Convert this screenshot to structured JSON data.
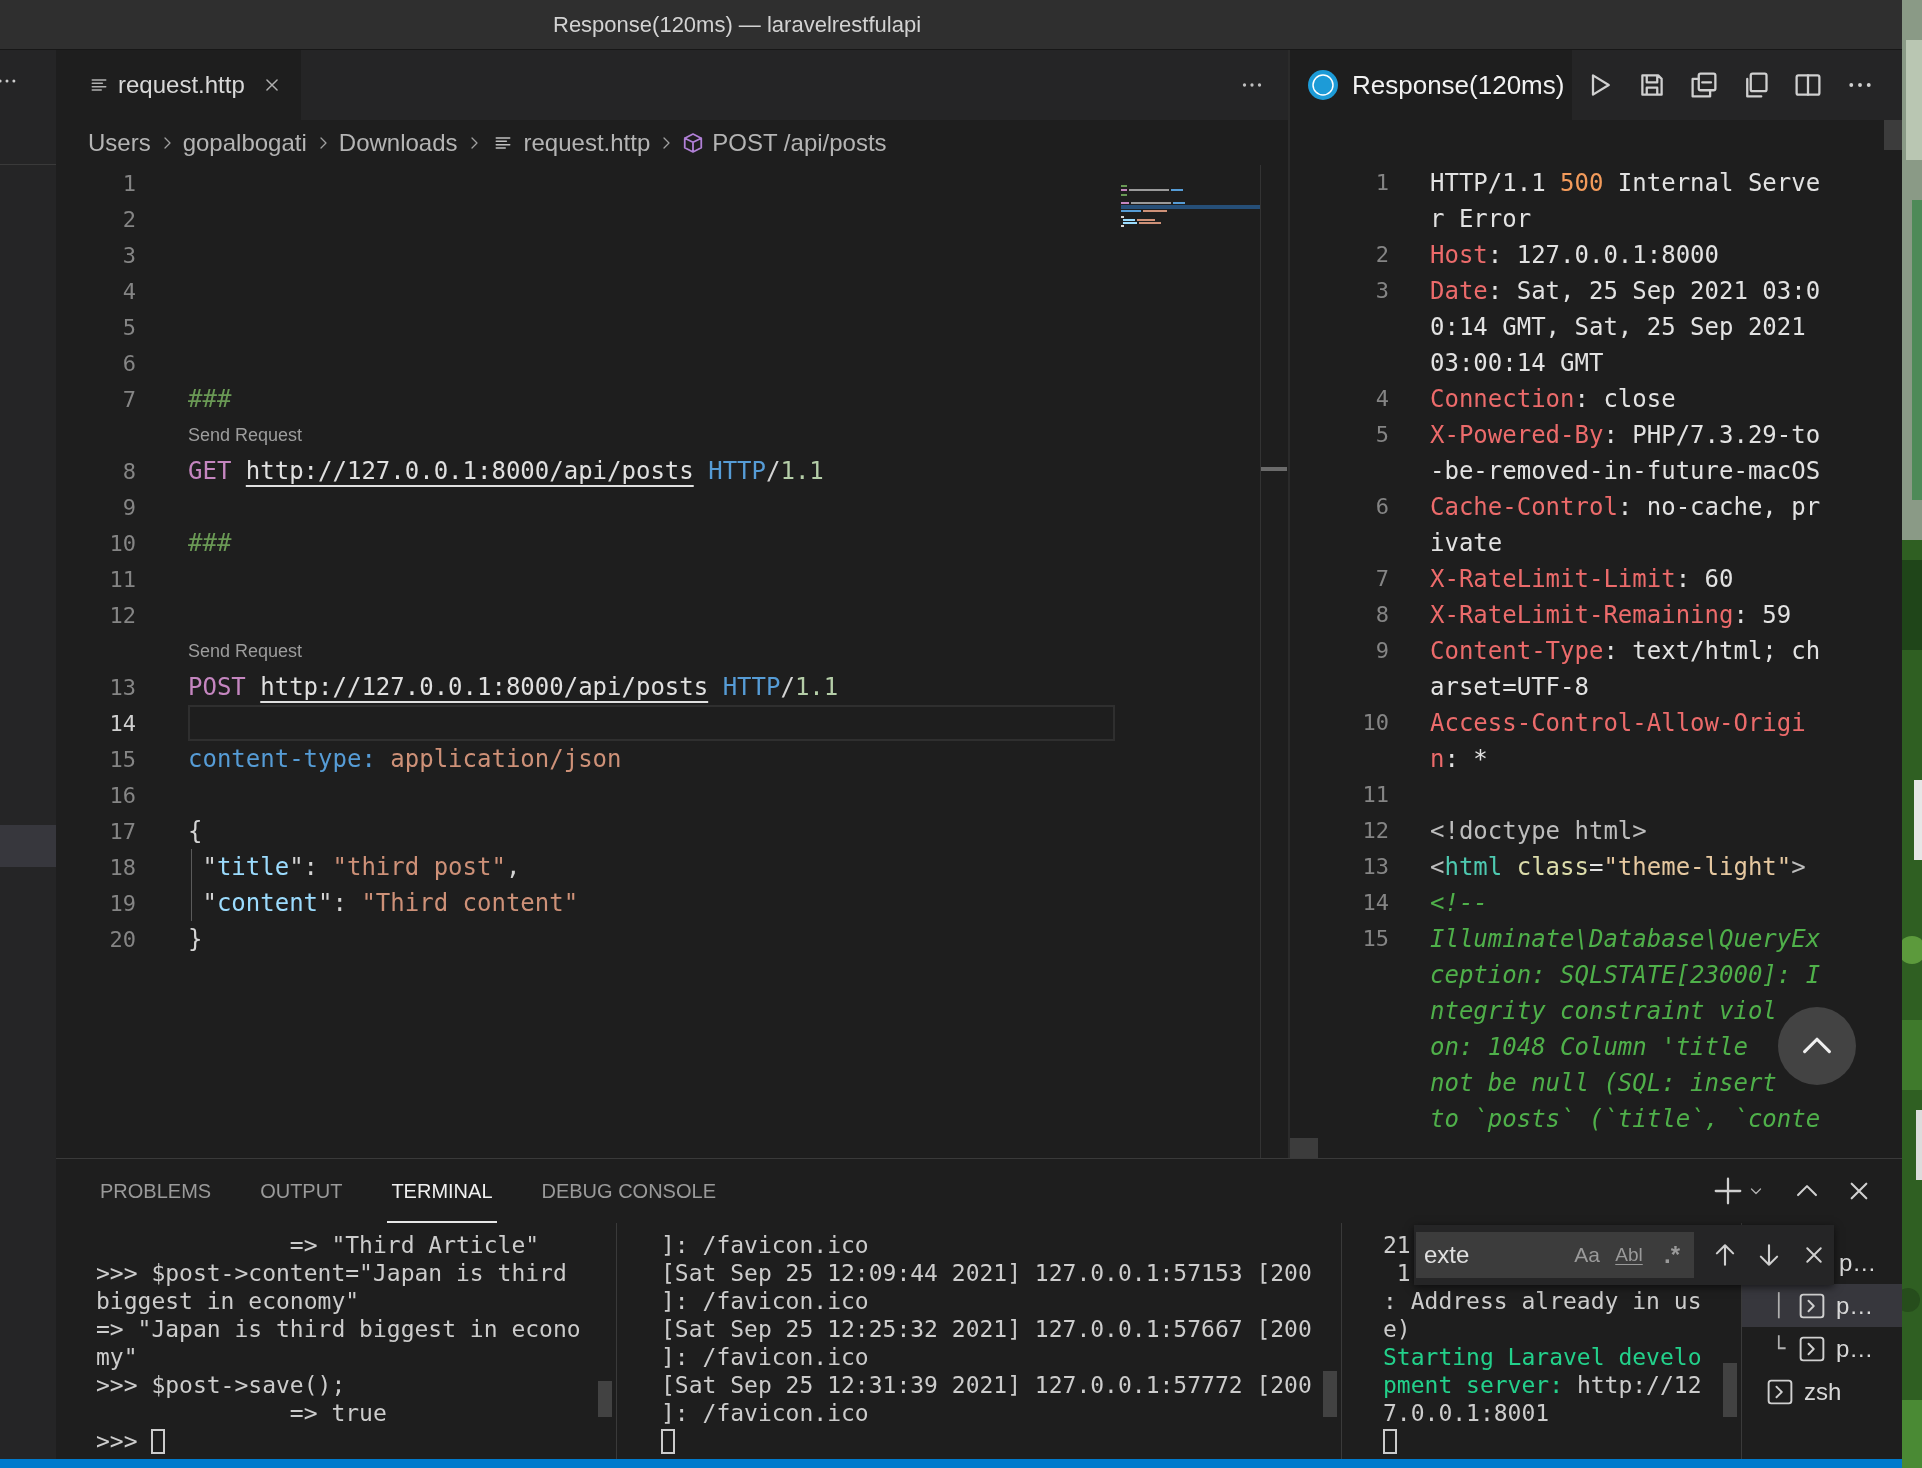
{
  "window": {
    "title": "Response(120ms) — laravelrestfulapi"
  },
  "editor": {
    "tabs": [
      {
        "label": "request.http",
        "selected": true
      }
    ],
    "breadcrumb": [
      {
        "label": "Users",
        "kind": "folder"
      },
      {
        "label": "gopalbogati",
        "kind": "folder"
      },
      {
        "label": "Downloads",
        "kind": "folder"
      },
      {
        "label": "request.http",
        "kind": "file"
      },
      {
        "label": "POST /api/posts",
        "kind": "symbol"
      }
    ],
    "lines": [
      {
        "number": "1",
        "current": false,
        "guide": false
      },
      {
        "number": "2",
        "current": false,
        "guide": false
      },
      {
        "number": "3",
        "current": false,
        "guide": false
      },
      {
        "number": "4",
        "current": false,
        "guide": false
      },
      {
        "number": "5",
        "current": false,
        "guide": false
      },
      {
        "number": "6",
        "current": false,
        "guide": false
      },
      {
        "number": "7",
        "current": false,
        "guide": false,
        "segments": [
          {
            "text": "###",
            "kind": "comment"
          }
        ]
      },
      {
        "number": "8",
        "current": false,
        "guide": false,
        "codelens": "Send Request",
        "segments": [
          {
            "text": "GET ",
            "kind": "method"
          },
          {
            "text": "http://127.0.0.1:8000/api/posts",
            "kind": "url"
          },
          {
            "text": " HTTP",
            "kind": "protocol"
          },
          {
            "text": "/",
            "kind": "plain"
          },
          {
            "text": "1.1",
            "kind": "version"
          }
        ]
      },
      {
        "number": "9",
        "current": false,
        "guide": false
      },
      {
        "number": "10",
        "current": false,
        "guide": false,
        "segments": [
          {
            "text": "###",
            "kind": "comment"
          }
        ]
      },
      {
        "number": "11",
        "current": false,
        "guide": false
      },
      {
        "number": "12",
        "current": false,
        "guide": false
      },
      {
        "number": "13",
        "current": false,
        "guide": false,
        "codelens": "Send Request",
        "segments": [
          {
            "text": "POST ",
            "kind": "method"
          },
          {
            "text": "http://127.0.0.1:8000/api/posts",
            "kind": "url"
          },
          {
            "text": " HTTP",
            "kind": "protocol"
          },
          {
            "text": "/",
            "kind": "plain"
          },
          {
            "text": "1.1",
            "kind": "version"
          }
        ]
      },
      {
        "number": "14",
        "current": true,
        "guide": false
      },
      {
        "number": "15",
        "current": false,
        "guide": false,
        "segments": [
          {
            "text": "content-type:",
            "kind": "key"
          },
          {
            "text": " application/json",
            "kind": "value"
          }
        ]
      },
      {
        "number": "16",
        "current": false,
        "guide": false
      },
      {
        "number": "17",
        "current": false,
        "guide": false,
        "segments": [
          {
            "text": "{",
            "kind": "plain"
          }
        ]
      },
      {
        "number": "18",
        "current": false,
        "guide": true,
        "segments": [
          {
            "text": " \"",
            "kind": "plain"
          },
          {
            "text": "title",
            "kind": "json_key"
          },
          {
            "text": "\": ",
            "kind": "plain"
          },
          {
            "text": "\"third post\"",
            "kind": "json_string"
          },
          {
            "text": ",",
            "kind": "plain"
          }
        ]
      },
      {
        "number": "19",
        "current": false,
        "guide": true,
        "segments": [
          {
            "text": " \"",
            "kind": "plain"
          },
          {
            "text": "content",
            "kind": "json_key"
          },
          {
            "text": "\": ",
            "kind": "plain"
          },
          {
            "text": "\"Third content\"",
            "kind": "json_string"
          }
        ]
      },
      {
        "number": "20",
        "current": false,
        "guide": false,
        "segments": [
          {
            "text": "}",
            "kind": "plain"
          }
        ]
      }
    ]
  },
  "response": {
    "tab": {
      "label": "Response(120ms)"
    },
    "lines": [
      {
        "number": "1",
        "rows": [
          [
            {
              "text": "HTTP/1.1 ",
              "kind": "plain"
            },
            {
              "text": "500",
              "kind": "status"
            },
            {
              "text": " Internal Serve",
              "kind": "plain"
            }
          ],
          [
            {
              "text": "r Error",
              "kind": "plain"
            }
          ]
        ]
      },
      {
        "number": "2",
        "rows": [
          [
            {
              "text": "Host",
              "kind": "name"
            },
            {
              "text": ": 127.0.0.1:8000",
              "kind": "plain"
            }
          ]
        ]
      },
      {
        "number": "3",
        "rows": [
          [
            {
              "text": "Date",
              "kind": "name"
            },
            {
              "text": ": Sat, 25 Sep 2021 03:0",
              "kind": "plain"
            }
          ],
          [
            {
              "text": "0:14 GMT, Sat, 25 Sep 2021",
              "kind": "plain"
            }
          ],
          [
            {
              "text": "03:00:14 GMT",
              "kind": "plain"
            }
          ]
        ]
      },
      {
        "number": "4",
        "rows": [
          [
            {
              "text": "Connection",
              "kind": "name"
            },
            {
              "text": ": close",
              "kind": "plain"
            }
          ]
        ]
      },
      {
        "number": "5",
        "rows": [
          [
            {
              "text": "X-Powered-By",
              "kind": "name"
            },
            {
              "text": ": PHP/7.3.29-to",
              "kind": "plain"
            }
          ],
          [
            {
              "text": "-be-removed-in-future-macOS",
              "kind": "plain"
            }
          ]
        ]
      },
      {
        "number": "6",
        "rows": [
          [
            {
              "text": "Cache-Control",
              "kind": "name"
            },
            {
              "text": ": no-cache, pr",
              "kind": "plain"
            }
          ],
          [
            {
              "text": "ivate",
              "kind": "plain"
            }
          ]
        ]
      },
      {
        "number": "7",
        "rows": [
          [
            {
              "text": "X-RateLimit-Limit",
              "kind": "name"
            },
            {
              "text": ": 60",
              "kind": "plain"
            }
          ]
        ]
      },
      {
        "number": "8",
        "rows": [
          [
            {
              "text": "X-RateLimit-Remaining",
              "kind": "name"
            },
            {
              "text": ": 59",
              "kind": "plain"
            }
          ]
        ]
      },
      {
        "number": "9",
        "rows": [
          [
            {
              "text": "Content-Type",
              "kind": "name"
            },
            {
              "text": ": text/html; ch",
              "kind": "plain"
            }
          ],
          [
            {
              "text": "arset=UTF-8",
              "kind": "plain"
            }
          ]
        ]
      },
      {
        "number": "10",
        "rows": [
          [
            {
              "text": "Access-Control-Allow-Origi",
              "kind": "name"
            }
          ],
          [
            {
              "text": "n",
              "kind": "name"
            },
            {
              "text": ": *",
              "kind": "plain"
            }
          ]
        ]
      },
      {
        "number": "11"
      },
      {
        "number": "12",
        "rows": [
          [
            {
              "text": "<!doctype html>",
              "kind": "punct"
            }
          ]
        ]
      },
      {
        "number": "13",
        "rows": [
          [
            {
              "text": "<",
              "kind": "punct"
            },
            {
              "text": "html",
              "kind": "tag"
            },
            {
              "text": " ",
              "kind": "plain"
            },
            {
              "text": "class",
              "kind": "attr"
            },
            {
              "text": "=",
              "kind": "plain"
            },
            {
              "text": "\"theme-light\"",
              "kind": "string"
            },
            {
              "text": ">",
              "kind": "punct"
            }
          ]
        ]
      },
      {
        "number": "14",
        "rows": [
          [
            {
              "text": "<!--",
              "kind": "comment"
            }
          ]
        ]
      },
      {
        "number": "15",
        "rows": [
          [
            {
              "text": "Illuminate\\Database\\QueryEx",
              "kind": "comment"
            }
          ],
          [
            {
              "text": "ception: SQLSTATE[23000]: I",
              "kind": "comment"
            }
          ],
          [
            {
              "text": "ntegrity constraint viol",
              "kind": "comment"
            }
          ],
          [
            {
              "text": "on: 1048 Column 'title",
              "kind": "comment"
            }
          ],
          [
            {
              "text": "not be null (SQL: insert",
              "kind": "comment"
            }
          ],
          [
            {
              "text": "to `posts` (`title`, `conte",
              "kind": "comment"
            }
          ]
        ]
      }
    ]
  },
  "panel": {
    "tabs": [
      {
        "label": "PROBLEMS",
        "selected": false
      },
      {
        "label": "OUTPUT",
        "selected": false
      },
      {
        "label": "TERMINAL",
        "selected": true
      },
      {
        "label": "DEBUG CONSOLE",
        "selected": false
      }
    ],
    "terminals": [
      {
        "prompt": ">>> ",
        "rows": [
          [
            {
              "text": "              => \"Third Article\"",
              "kind": "plain"
            }
          ],
          [
            {
              "text": ">>> $post->content=\"Japan is third",
              "kind": "plain"
            }
          ],
          [
            {
              "text": "biggest in economy\"",
              "kind": "plain"
            }
          ],
          [
            {
              "text": "=> \"Japan is third biggest in econo",
              "kind": "plain"
            }
          ],
          [
            {
              "text": "my\"",
              "kind": "plain"
            }
          ],
          [
            {
              "text": ">>> $post->save();",
              "kind": "plain"
            }
          ],
          [
            {
              "text": "              => true",
              "kind": "plain"
            }
          ]
        ]
      },
      {
        "rows": [
          [
            {
              "text": "]: /favicon.ico",
              "kind": "plain"
            }
          ],
          [
            {
              "text": "[Sat Sep 25 12:09:44 2021] 127.0.0.1:57153 [200",
              "kind": "plain"
            }
          ],
          [
            {
              "text": "]: /favicon.ico",
              "kind": "plain"
            }
          ],
          [
            {
              "text": "[Sat Sep 25 12:25:32 2021] 127.0.0.1:57667 [200",
              "kind": "plain"
            }
          ],
          [
            {
              "text": "]: /favicon.ico",
              "kind": "plain"
            }
          ],
          [
            {
              "text": "[Sat Sep 25 12:31:39 2021] 127.0.0.1:57772 [200",
              "kind": "plain"
            }
          ],
          [
            {
              "text": "]: /favicon.ico",
              "kind": "plain"
            }
          ]
        ]
      },
      {
        "rows": [
          [
            {
              "text": "21",
              "kind": "plain"
            }
          ],
          [
            {
              "text": " 1",
              "kind": "plain"
            }
          ],
          [
            {
              "text": ": Address already in us",
              "kind": "plain"
            }
          ],
          [
            {
              "text": "e)",
              "kind": "plain"
            }
          ],
          [
            {
              "text": "Starting Laravel develo",
              "kind": "green"
            }
          ],
          [
            {
              "text": "pment server: ",
              "kind": "green"
            },
            {
              "text": "http://12",
              "kind": "plain"
            }
          ],
          [
            {
              "text": "7.0.0.1:8001",
              "kind": "plain"
            }
          ]
        ]
      }
    ],
    "find": {
      "value": "exte",
      "options": [
        "Aa",
        "Abl",
        ".*"
      ]
    },
    "terminal_list": [
      {
        "label": "p…",
        "selected": false,
        "icon": false
      },
      {
        "label": "p…",
        "selected": true,
        "icon": true,
        "tree": "│"
      },
      {
        "label": "p…",
        "selected": false,
        "icon": true,
        "tree": "└"
      },
      {
        "label": "zsh",
        "selected": false,
        "icon": true
      }
    ]
  }
}
